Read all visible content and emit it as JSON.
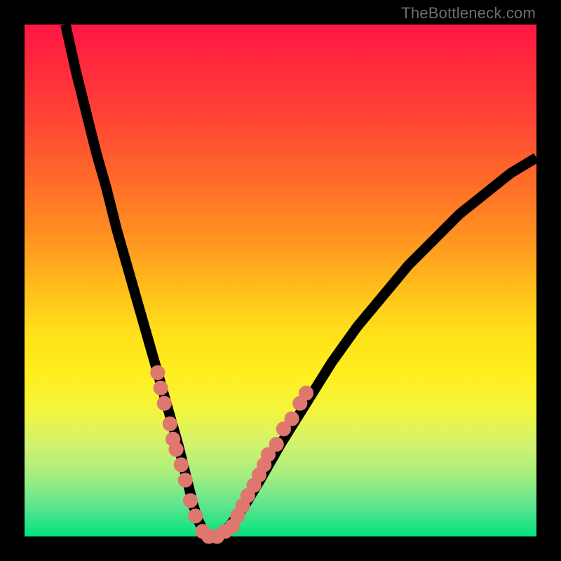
{
  "watermark": "TheBottleneck.com",
  "colors": {
    "frame_bg": "#000000",
    "curve": "#000000",
    "dots": "#e0776e",
    "gradient_stops": [
      "#ff1744",
      "#ff6a2a",
      "#ffe01a",
      "#00e37e"
    ]
  },
  "chart_data": {
    "type": "line",
    "title": "",
    "xlabel": "",
    "ylabel": "",
    "xlim": [
      0,
      100
    ],
    "ylim": [
      0,
      100
    ],
    "grid": false,
    "legend": false,
    "series": [
      {
        "name": "curve",
        "x": [
          8,
          10,
          12,
          14,
          16,
          18,
          20,
          22,
          24,
          26,
          28,
          30,
          31,
          32,
          33,
          34,
          35,
          36,
          38,
          40,
          43,
          46,
          50,
          55,
          60,
          65,
          70,
          75,
          80,
          85,
          90,
          95,
          100
        ],
        "y": [
          100,
          91,
          83,
          75,
          68,
          60,
          53,
          46,
          39,
          32,
          25,
          18,
          14,
          10,
          6,
          3,
          1,
          0,
          0,
          2,
          6,
          11,
          18,
          26,
          34,
          41,
          47,
          53,
          58,
          63,
          67,
          71,
          74
        ]
      }
    ],
    "highlight_points": [
      {
        "x": 26.0,
        "y": 32
      },
      {
        "x": 26.6,
        "y": 29
      },
      {
        "x": 27.3,
        "y": 26
      },
      {
        "x": 28.4,
        "y": 22
      },
      {
        "x": 29.0,
        "y": 19
      },
      {
        "x": 29.6,
        "y": 17
      },
      {
        "x": 30.6,
        "y": 14
      },
      {
        "x": 31.4,
        "y": 11
      },
      {
        "x": 32.4,
        "y": 7
      },
      {
        "x": 33.4,
        "y": 4
      },
      {
        "x": 34.8,
        "y": 1
      },
      {
        "x": 36.0,
        "y": 0
      },
      {
        "x": 37.6,
        "y": 0
      },
      {
        "x": 39.2,
        "y": 1
      },
      {
        "x": 40.6,
        "y": 2
      },
      {
        "x": 41.6,
        "y": 4
      },
      {
        "x": 42.6,
        "y": 6
      },
      {
        "x": 43.6,
        "y": 8
      },
      {
        "x": 44.8,
        "y": 10
      },
      {
        "x": 45.8,
        "y": 12
      },
      {
        "x": 46.8,
        "y": 14
      },
      {
        "x": 47.6,
        "y": 16
      },
      {
        "x": 49.2,
        "y": 18
      },
      {
        "x": 50.6,
        "y": 21
      },
      {
        "x": 52.2,
        "y": 23
      },
      {
        "x": 53.8,
        "y": 26
      },
      {
        "x": 55.0,
        "y": 28
      }
    ],
    "annotations": []
  }
}
